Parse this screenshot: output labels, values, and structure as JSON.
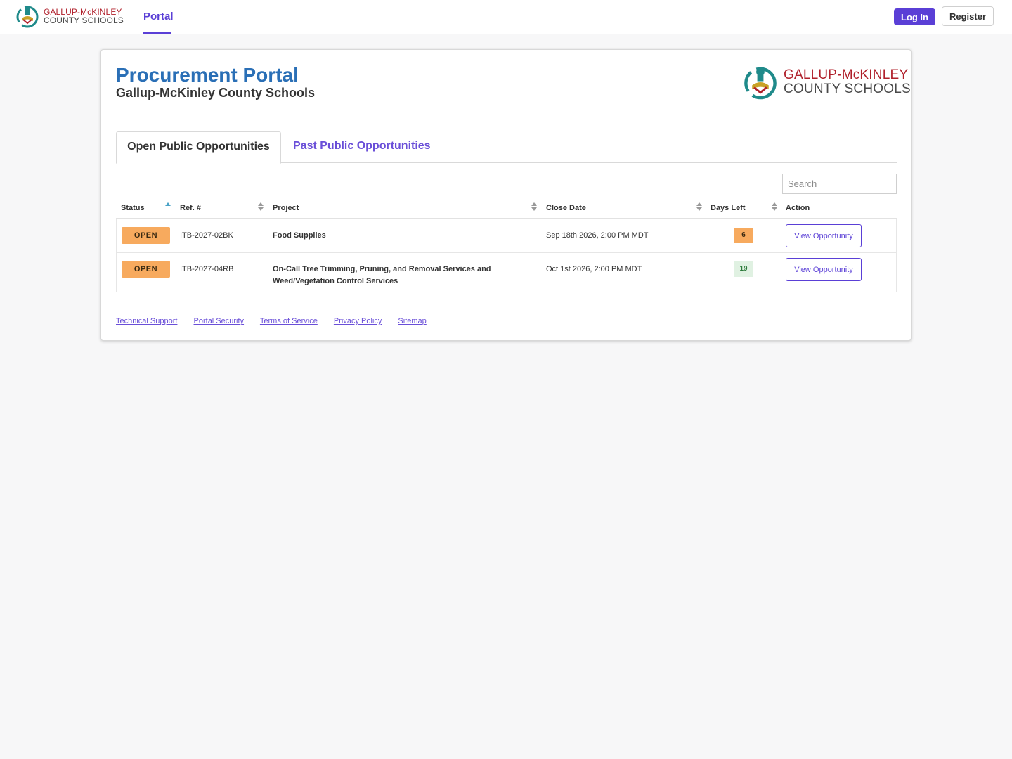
{
  "topnav": {
    "logo": {
      "line1": "GALLUP-McKINLEY",
      "line2": "COUNTY SCHOOLS"
    },
    "tab_portal": "Portal",
    "login_label": "Log In",
    "register_label": "Register"
  },
  "header": {
    "title": "Procurement Portal",
    "subtitle": "Gallup-McKinley County Schools",
    "logo": {
      "line1": "GALLUP-McKINLEY",
      "line2": "COUNTY SCHOOLS"
    }
  },
  "tabs": {
    "open": "Open Public Opportunities",
    "past": "Past Public Opportunities"
  },
  "search": {
    "placeholder": "Search"
  },
  "table": {
    "headers": {
      "status": "Status",
      "ref": "Ref. #",
      "project": "Project",
      "close_date": "Close Date",
      "days_left": "Days Left",
      "action": "Action"
    },
    "rows": [
      {
        "status": "OPEN",
        "ref": "ITB-2027-02BK",
        "project": "Food Supplies",
        "close_date": "Sep 18th 2026, 2:00 PM MDT",
        "days_left": "6",
        "action": "View Opportunity"
      },
      {
        "status": "OPEN",
        "ref": "ITB-2027-04RB",
        "project": "On-Call Tree Trimming, Pruning, and Removal Services and Weed/Vegetation Control Services",
        "close_date": "Oct 1st 2026, 2:00 PM MDT",
        "days_left": "19",
        "action": "View Opportunity"
      }
    ]
  },
  "footer": {
    "links": [
      "Technical Support",
      "Portal Security",
      "Terms of Service",
      "Privacy Policy",
      "Sitemap"
    ]
  },
  "colors": {
    "accent": "#5a3fd6",
    "title_blue": "#2a6fb6",
    "status_open": "#f7aa5e",
    "days_ok_bg": "#e0f1e2",
    "logo_red": "#b0202b"
  }
}
